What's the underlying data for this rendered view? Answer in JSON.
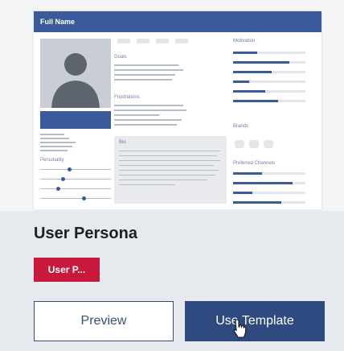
{
  "thumbnail": {
    "header_title": "Full Name",
    "sections": {
      "goals": "Goals",
      "frustrations": "Frustrations",
      "bio": "Bio",
      "personality": "Personality",
      "motivation": "Motivation",
      "brands": "Brands",
      "preferred_channels": "Preferred Channels"
    }
  },
  "template": {
    "title": "User Persona",
    "badge": "User P..."
  },
  "buttons": {
    "preview": "Preview",
    "use_template": "Use Template"
  },
  "colors": {
    "header_blue": "#3b5a9a",
    "badge_red": "#c8193c",
    "primary_button": "#2f4a80"
  }
}
